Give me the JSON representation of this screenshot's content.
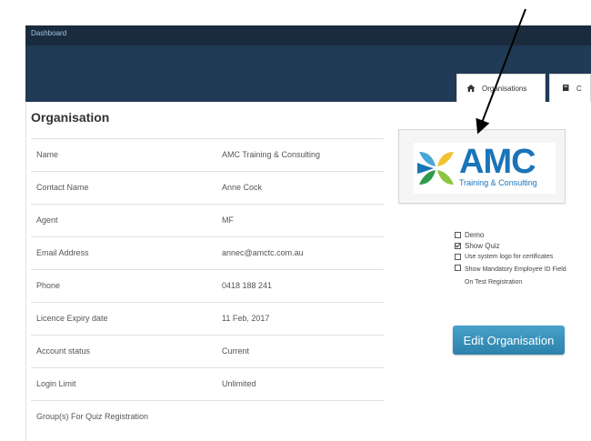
{
  "breadcrumb": "Dashboard",
  "tabs": [
    {
      "label": "Organisations",
      "icon": "home-icon"
    },
    {
      "label": "C",
      "icon": "book-icon"
    }
  ],
  "page_title": "Organisation",
  "details": [
    {
      "label": "Name",
      "value": "AMC Training & Consulting"
    },
    {
      "label": "Contact Name",
      "value": "Anne Cock"
    },
    {
      "label": "Agent",
      "value": "MF"
    },
    {
      "label": "Email Address",
      "value": "annec@amctc.com.au"
    },
    {
      "label": "Phone",
      "value": "0418 188 241"
    },
    {
      "label": "Licence Expiry date",
      "value": "11 Feb, 2017"
    },
    {
      "label": "Account status",
      "value": "Current"
    },
    {
      "label": "Login Limit",
      "value": "Unlimited"
    },
    {
      "label": "Group(s) For Quiz Registration",
      "value": ""
    }
  ],
  "logo": {
    "name": "AMC",
    "tagline": "Training & Consulting"
  },
  "options": [
    {
      "label": "Demo",
      "checked": false
    },
    {
      "label": "Show Quiz",
      "checked": true
    },
    {
      "label": "Use system logo for certificates",
      "checked": false
    },
    {
      "label": "Show Mandatory Employee ID Field On Test Registration",
      "checked": false
    }
  ],
  "edit_button": "Edit Organisation",
  "colors": {
    "header": "#213a56",
    "topbar": "#1a2b3e",
    "button": "#3690b8",
    "logo": "#1a74b8"
  }
}
